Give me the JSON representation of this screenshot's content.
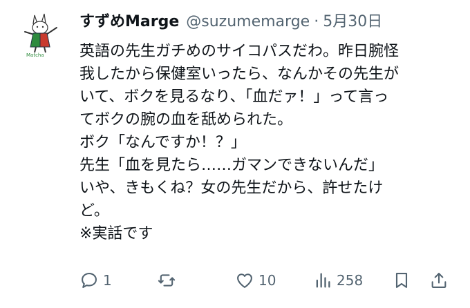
{
  "tweet": {
    "display_name": "すずめMarge",
    "handle": "@suzumemarge",
    "separator": "·",
    "date": "5月30日",
    "lines": [
      "英語の先生ガチめのサイコパスだわ。昨日腕怪",
      "我したから保健室いったら、なんかその先生が",
      "いて、ボクを見るなり、「血だァ！」って言っ",
      "てボクの腕の血を舐められた。",
      "ボク「なんですか！？」",
      "先生「血を見たら……ガマンできないんだ」",
      "いや、きもくね？女の先生だから、許せたけ",
      "ど。",
      "※実話です"
    ]
  },
  "avatar": {
    "caption": "Matcha",
    "icon": "cat-avatar-icon"
  },
  "actions": {
    "reply": {
      "icon": "reply-icon",
      "count": "1"
    },
    "retweet": {
      "icon": "retweet-icon",
      "count": ""
    },
    "like": {
      "icon": "heart-icon",
      "count": "10"
    },
    "views": {
      "icon": "views-icon",
      "count": "258"
    },
    "bookmark": {
      "icon": "bookmark-icon"
    },
    "share": {
      "icon": "share-icon"
    }
  },
  "colors": {
    "text": "#0f1419",
    "muted": "#536471",
    "avatar_green": "#2e8b3e",
    "avatar_red": "#c83a2e"
  }
}
